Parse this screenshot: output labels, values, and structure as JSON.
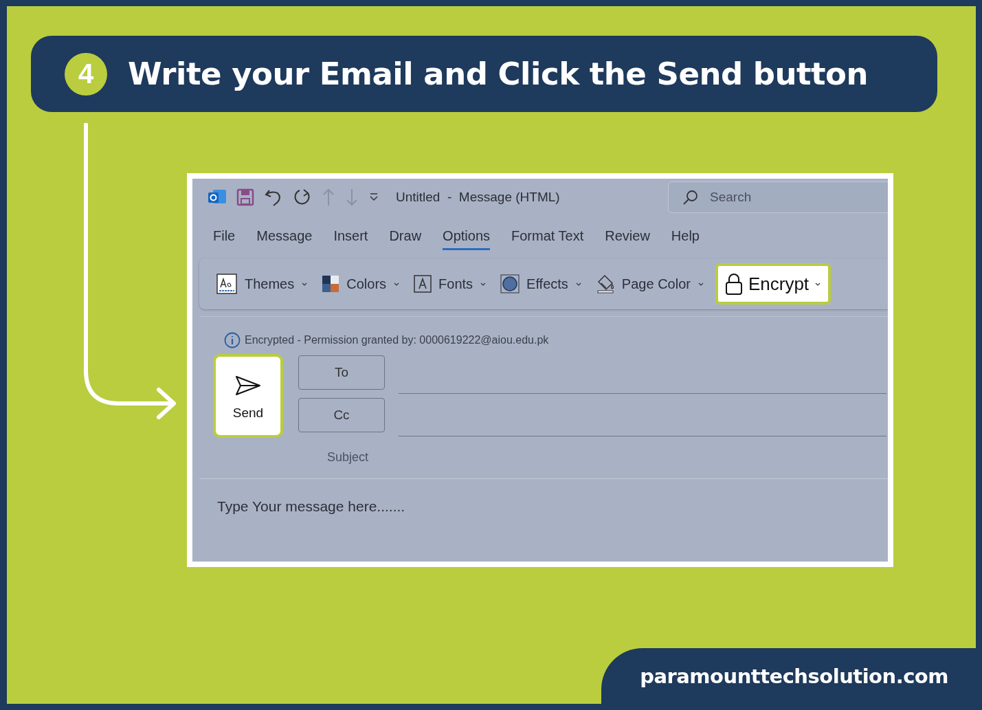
{
  "step": {
    "number": "4",
    "title": "Write your Email and Click the Send button"
  },
  "window": {
    "title": "Untitled  -  Message (HTML)",
    "search": {
      "placeholder": "Search"
    }
  },
  "menu_tabs": [
    {
      "label": "File",
      "selected": false
    },
    {
      "label": "Message",
      "selected": false
    },
    {
      "label": "Insert",
      "selected": false
    },
    {
      "label": "Draw",
      "selected": false
    },
    {
      "label": "Options",
      "selected": true
    },
    {
      "label": "Format Text",
      "selected": false
    },
    {
      "label": "Review",
      "selected": false
    },
    {
      "label": "Help",
      "selected": false
    }
  ],
  "ribbon": [
    {
      "label": "Themes",
      "highlighted": false
    },
    {
      "label": "Colors",
      "highlighted": false
    },
    {
      "label": "Fonts",
      "highlighted": false
    },
    {
      "label": "Effects",
      "highlighted": false
    },
    {
      "label": "Page Color",
      "highlighted": false
    },
    {
      "label": "Encrypt",
      "highlighted": true
    }
  ],
  "info_bar": "Encrypted - Permission granted by: 0000619222@aiou.edu.pk",
  "send_button": {
    "label": "Send",
    "highlighted": true
  },
  "recipients": [
    {
      "label": "To"
    },
    {
      "label": "Cc"
    }
  ],
  "subject": {
    "label": "Subject"
  },
  "body": {
    "text": "Type Your message here......."
  },
  "footer": {
    "website": "paramounttechsolution.com"
  }
}
